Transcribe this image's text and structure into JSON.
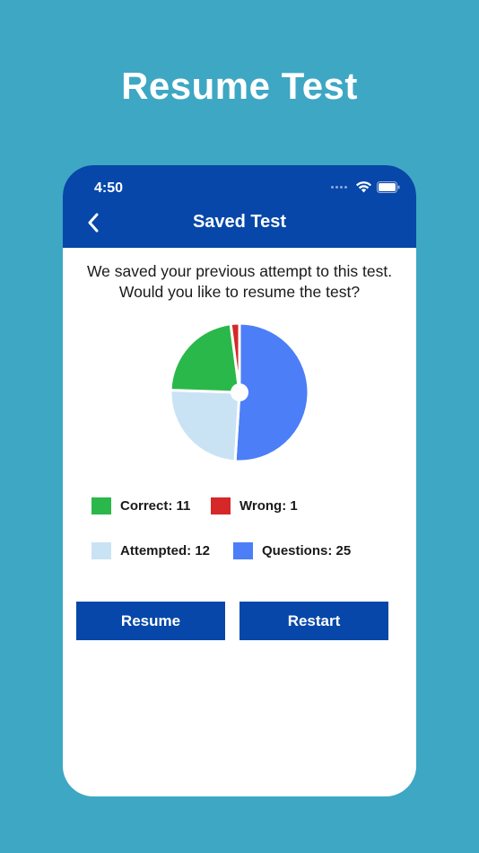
{
  "promo": {
    "title": "Resume Test"
  },
  "status_bar": {
    "time": "4:50"
  },
  "nav": {
    "title": "Saved Test"
  },
  "message": {
    "line1": "We saved your previous attempt to this test.",
    "line2": "Would you like to resume the test?"
  },
  "colors": {
    "background": "#3ea7c4",
    "primary": "#0647a9",
    "correct": "#2bb84a",
    "wrong": "#d62828",
    "attempted": "#c9e3f4",
    "questions": "#4c7ef7"
  },
  "chart_data": {
    "type": "pie",
    "slices": [
      {
        "name": "Questions",
        "value": 25,
        "color": "#4c7ef7"
      },
      {
        "name": "Attempted",
        "value": 12,
        "color": "#c9e3f4"
      },
      {
        "name": "Correct",
        "value": 11,
        "color": "#2bb84a"
      },
      {
        "name": "Wrong",
        "value": 1,
        "color": "#d62828"
      }
    ]
  },
  "legend": {
    "correct": "Correct: 11",
    "wrong": "Wrong: 1",
    "attempted": "Attempted: 12",
    "questions": "Questions: 25"
  },
  "buttons": {
    "resume": "Resume",
    "restart": "Restart"
  }
}
